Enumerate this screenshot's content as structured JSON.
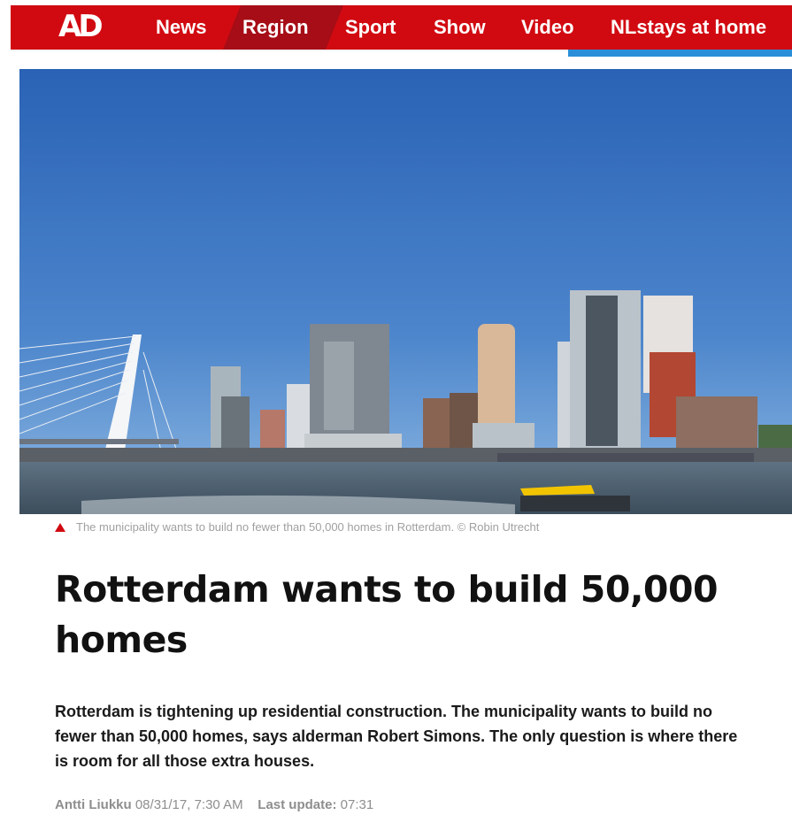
{
  "brand": {
    "logo_text": "AD",
    "color": "#d10a11",
    "active_color": "#a60d16",
    "accent_blue": "#2a8fd8"
  },
  "nav": {
    "items": [
      {
        "label": "News"
      },
      {
        "label": "Region",
        "active": true
      },
      {
        "label": "Sport"
      },
      {
        "label": "Show"
      },
      {
        "label": "Video"
      },
      {
        "label": "NLstays at home"
      }
    ]
  },
  "hero": {
    "icon": "rotterdam-skyline-photo"
  },
  "caption": {
    "icon": "triangle-up-icon",
    "text": "The municipality wants to build no fewer than 50,000 homes in Rotterdam. © Robin Utrecht"
  },
  "article": {
    "title": "Rotterdam wants to build 50,000 homes",
    "lead": "Rotterdam is tightening up residential construction. The municipality wants to build no fewer than 50,000 homes, says alderman Robert Simons. The only question is where there is room for all those extra houses.",
    "author": "Antti Liukku",
    "published": "08/31/17, 7:30 AM",
    "last_update_label": "Last update:",
    "last_update_value": "07:31"
  }
}
